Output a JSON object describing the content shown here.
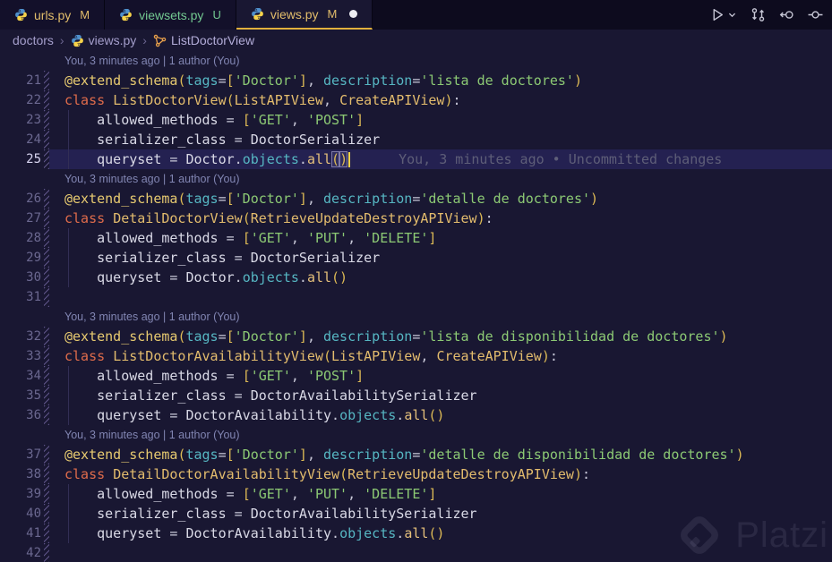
{
  "colors": {
    "editor_bg": "#191732",
    "tabbar_bg": "#0D0B1E",
    "accent_gold": "#E2B13D",
    "git_modified": "#E2BD6B",
    "git_untracked": "#73C991",
    "keyword": "#E06C4B",
    "string": "#8CC974",
    "class_name": "#E3BC6D",
    "param": "#56B6C2",
    "cursor": "#F2D24B"
  },
  "tabs": [
    {
      "label": "urls.py",
      "badge": "M",
      "status": "modified",
      "icon": "python-icon",
      "active": false,
      "dirty": false
    },
    {
      "label": "viewsets.py",
      "badge": "U",
      "status": "untracked",
      "icon": "python-icon",
      "active": false,
      "dirty": false
    },
    {
      "label": "views.py",
      "badge": "M",
      "status": "modified",
      "icon": "python-icon",
      "active": true,
      "dirty": true
    }
  ],
  "toolbar": {
    "icons": [
      "run-python-file-icon",
      "run-dropdown-chevron-icon",
      "compare-changes-icon",
      "open-changes-icon",
      "toggle-blame-icon"
    ]
  },
  "breadcrumb": {
    "items": [
      {
        "label": "doctors",
        "icon": null
      },
      {
        "label": "views.py",
        "icon": "python-icon"
      },
      {
        "label": "ListDoctorView",
        "icon": "class-symbol-icon"
      }
    ],
    "separator": "›"
  },
  "watermark": {
    "text": "Platzi",
    "logo": "platzi-logo-icon"
  },
  "editor": {
    "rows": [
      {
        "lens": "You, 3 minutes ago | 1 author (You)"
      },
      {
        "n": 21,
        "seg": [
          [
            "dec",
            "@extend_schema"
          ],
          [
            "brk",
            "("
          ],
          [
            "prm",
            "tags"
          ],
          [
            "pun",
            "="
          ],
          [
            "brk",
            "["
          ],
          [
            "str",
            "'Doctor'"
          ],
          [
            "brk",
            "]"
          ],
          [
            "pun",
            ", "
          ],
          [
            "prm",
            "description"
          ],
          [
            "pun",
            "="
          ],
          [
            "str",
            "'lista de doctores'"
          ],
          [
            "brk",
            ")"
          ]
        ]
      },
      {
        "n": 22,
        "seg": [
          [
            "kw",
            "class "
          ],
          [
            "cls",
            "ListDoctorView"
          ],
          [
            "brk",
            "("
          ],
          [
            "cls",
            "ListAPIView"
          ],
          [
            "pun",
            ", "
          ],
          [
            "cls",
            "CreateAPIView"
          ],
          [
            "brk",
            ")"
          ],
          [
            "pun",
            ":"
          ]
        ]
      },
      {
        "n": 23,
        "ind": 1,
        "seg": [
          [
            "idn",
            "    allowed_methods "
          ],
          [
            "pun",
            "= "
          ],
          [
            "brk",
            "["
          ],
          [
            "str",
            "'GET'"
          ],
          [
            "pun",
            ", "
          ],
          [
            "str",
            "'POST'"
          ],
          [
            "brk",
            "]"
          ]
        ]
      },
      {
        "n": 24,
        "ind": 1,
        "seg": [
          [
            "idn",
            "    serializer_class "
          ],
          [
            "pun",
            "= "
          ],
          [
            "idn",
            "DoctorSerializer"
          ]
        ]
      },
      {
        "n": 25,
        "ind": 1,
        "cur": true,
        "seg": [
          [
            "idn",
            "    queryset "
          ],
          [
            "pun",
            "= "
          ],
          [
            "idn",
            "Doctor"
          ],
          [
            "pun",
            "."
          ],
          [
            "prm",
            "objects"
          ],
          [
            "pun",
            "."
          ],
          [
            "fn",
            "all"
          ],
          [
            "brkbox",
            "("
          ],
          [
            "brkbox",
            ")"
          ],
          [
            "cursor",
            ""
          ],
          [
            "blame",
            "You, 3 minutes ago • Uncommitted changes"
          ]
        ]
      },
      {
        "lens": "You, 3 minutes ago | 1 author (You)"
      },
      {
        "n": 26,
        "seg": [
          [
            "dec",
            "@extend_schema"
          ],
          [
            "brk",
            "("
          ],
          [
            "prm",
            "tags"
          ],
          [
            "pun",
            "="
          ],
          [
            "brk",
            "["
          ],
          [
            "str",
            "'Doctor'"
          ],
          [
            "brk",
            "]"
          ],
          [
            "pun",
            ", "
          ],
          [
            "prm",
            "description"
          ],
          [
            "pun",
            "="
          ],
          [
            "str",
            "'detalle de doctores'"
          ],
          [
            "brk",
            ")"
          ]
        ]
      },
      {
        "n": 27,
        "seg": [
          [
            "kw",
            "class "
          ],
          [
            "cls",
            "DetailDoctorView"
          ],
          [
            "brk",
            "("
          ],
          [
            "cls",
            "RetrieveUpdateDestroyAPIView"
          ],
          [
            "brk",
            ")"
          ],
          [
            "pun",
            ":"
          ]
        ]
      },
      {
        "n": 28,
        "ind": 1,
        "seg": [
          [
            "idn",
            "    allowed_methods "
          ],
          [
            "pun",
            "= "
          ],
          [
            "brk",
            "["
          ],
          [
            "str",
            "'GET'"
          ],
          [
            "pun",
            ", "
          ],
          [
            "str",
            "'PUT'"
          ],
          [
            "pun",
            ", "
          ],
          [
            "str",
            "'DELETE'"
          ],
          [
            "brk",
            "]"
          ]
        ]
      },
      {
        "n": 29,
        "ind": 1,
        "seg": [
          [
            "idn",
            "    serializer_class "
          ],
          [
            "pun",
            "= "
          ],
          [
            "idn",
            "DoctorSerializer"
          ]
        ]
      },
      {
        "n": 30,
        "ind": 1,
        "seg": [
          [
            "idn",
            "    queryset "
          ],
          [
            "pun",
            "= "
          ],
          [
            "idn",
            "Doctor"
          ],
          [
            "pun",
            "."
          ],
          [
            "prm",
            "objects"
          ],
          [
            "pun",
            "."
          ],
          [
            "fn",
            "all"
          ],
          [
            "brk",
            "()"
          ]
        ]
      },
      {
        "n": 31,
        "seg": []
      },
      {
        "lens": "You, 3 minutes ago | 1 author (You)"
      },
      {
        "n": 32,
        "seg": [
          [
            "dec",
            "@extend_schema"
          ],
          [
            "brk",
            "("
          ],
          [
            "prm",
            "tags"
          ],
          [
            "pun",
            "="
          ],
          [
            "brk",
            "["
          ],
          [
            "str",
            "'Doctor'"
          ],
          [
            "brk",
            "]"
          ],
          [
            "pun",
            ", "
          ],
          [
            "prm",
            "description"
          ],
          [
            "pun",
            "="
          ],
          [
            "str",
            "'lista de disponibilidad de doctores'"
          ],
          [
            "brk",
            ")"
          ]
        ]
      },
      {
        "n": 33,
        "seg": [
          [
            "kw",
            "class "
          ],
          [
            "cls",
            "ListDoctorAvailabilityView"
          ],
          [
            "brk",
            "("
          ],
          [
            "cls",
            "ListAPIView"
          ],
          [
            "pun",
            ", "
          ],
          [
            "cls",
            "CreateAPIView"
          ],
          [
            "brk",
            ")"
          ],
          [
            "pun",
            ":"
          ]
        ]
      },
      {
        "n": 34,
        "ind": 1,
        "seg": [
          [
            "idn",
            "    allowed_methods "
          ],
          [
            "pun",
            "= "
          ],
          [
            "brk",
            "["
          ],
          [
            "str",
            "'GET'"
          ],
          [
            "pun",
            ", "
          ],
          [
            "str",
            "'POST'"
          ],
          [
            "brk",
            "]"
          ]
        ]
      },
      {
        "n": 35,
        "ind": 1,
        "seg": [
          [
            "idn",
            "    serializer_class "
          ],
          [
            "pun",
            "= "
          ],
          [
            "idn",
            "DoctorAvailabilitySerializer"
          ]
        ]
      },
      {
        "n": 36,
        "ind": 1,
        "seg": [
          [
            "idn",
            "    queryset "
          ],
          [
            "pun",
            "= "
          ],
          [
            "idn",
            "DoctorAvailability"
          ],
          [
            "pun",
            "."
          ],
          [
            "prm",
            "objects"
          ],
          [
            "pun",
            "."
          ],
          [
            "fn",
            "all"
          ],
          [
            "brk",
            "()"
          ]
        ]
      },
      {
        "lens": "You, 3 minutes ago | 1 author (You)"
      },
      {
        "n": 37,
        "seg": [
          [
            "dec",
            "@extend_schema"
          ],
          [
            "brk",
            "("
          ],
          [
            "prm",
            "tags"
          ],
          [
            "pun",
            "="
          ],
          [
            "brk",
            "["
          ],
          [
            "str",
            "'Doctor'"
          ],
          [
            "brk",
            "]"
          ],
          [
            "pun",
            ", "
          ],
          [
            "prm",
            "description"
          ],
          [
            "pun",
            "="
          ],
          [
            "str",
            "'detalle de disponibilidad de doctores'"
          ],
          [
            "brk",
            ")"
          ]
        ]
      },
      {
        "n": 38,
        "seg": [
          [
            "kw",
            "class "
          ],
          [
            "cls",
            "DetailDoctorAvailabilityView"
          ],
          [
            "brk",
            "("
          ],
          [
            "cls",
            "RetrieveUpdateDestroyAPIView"
          ],
          [
            "brk",
            ")"
          ],
          [
            "pun",
            ":"
          ]
        ]
      },
      {
        "n": 39,
        "ind": 1,
        "seg": [
          [
            "idn",
            "    allowed_methods "
          ],
          [
            "pun",
            "= "
          ],
          [
            "brk",
            "["
          ],
          [
            "str",
            "'GET'"
          ],
          [
            "pun",
            ", "
          ],
          [
            "str",
            "'PUT'"
          ],
          [
            "pun",
            ", "
          ],
          [
            "str",
            "'DELETE'"
          ],
          [
            "brk",
            "]"
          ]
        ]
      },
      {
        "n": 40,
        "ind": 1,
        "seg": [
          [
            "idn",
            "    serializer_class "
          ],
          [
            "pun",
            "= "
          ],
          [
            "idn",
            "DoctorAvailabilitySerializer"
          ]
        ]
      },
      {
        "n": 41,
        "ind": 1,
        "seg": [
          [
            "idn",
            "    queryset "
          ],
          [
            "pun",
            "= "
          ],
          [
            "idn",
            "DoctorAvailability"
          ],
          [
            "pun",
            "."
          ],
          [
            "prm",
            "objects"
          ],
          [
            "pun",
            "."
          ],
          [
            "fn",
            "all"
          ],
          [
            "brk",
            "()"
          ]
        ]
      },
      {
        "n": 42,
        "seg": []
      }
    ]
  }
}
